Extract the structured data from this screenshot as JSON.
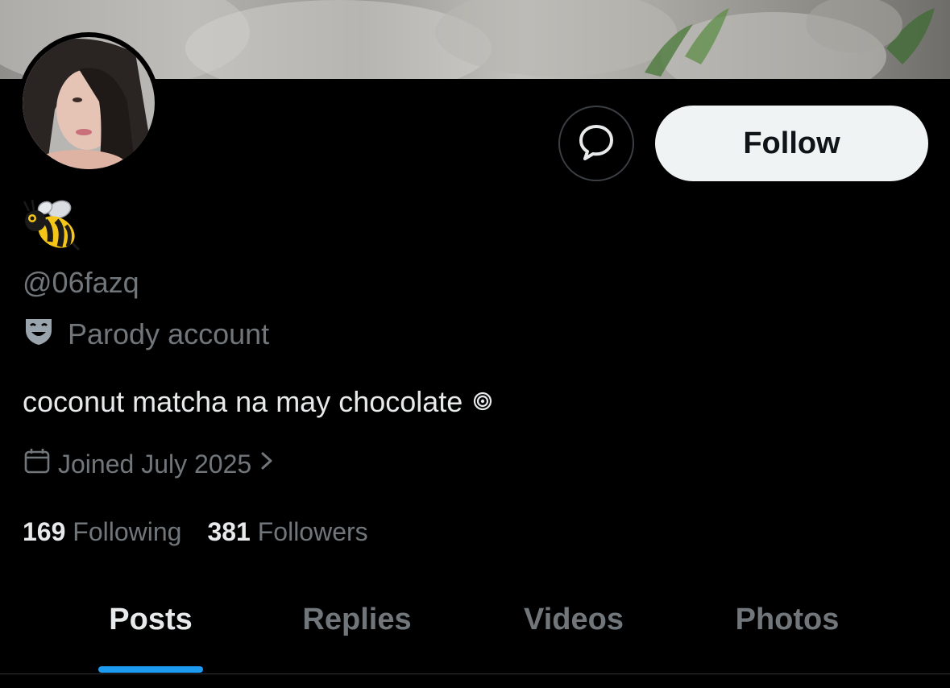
{
  "profile": {
    "display_name_icon": "bee-icon",
    "handle": "@06fazq",
    "parody_label": "Parody account",
    "parody_icon": "theater-mask-icon",
    "bio_text": "coconut matcha na may chocolate",
    "bio_icon": "spiral-icon",
    "joined": "Joined July 2025",
    "joined_icon": "calendar-icon",
    "joined_chevron_icon": "chevron-right-icon"
  },
  "actions": {
    "message_icon": "message-bubble-icon",
    "follow_label": "Follow"
  },
  "stats": {
    "following_count": "169",
    "following_label": "Following",
    "followers_count": "381",
    "followers_label": "Followers"
  },
  "tabs": [
    {
      "label": "Posts",
      "active": true
    },
    {
      "label": "Replies",
      "active": false
    },
    {
      "label": "Videos",
      "active": false
    },
    {
      "label": "Photos",
      "active": false
    }
  ],
  "colors": {
    "background": "#000000",
    "text_primary": "#e7e9ea",
    "text_secondary": "#71767b",
    "accent": "#1d9bf0",
    "follow_button_bg": "#eff3f4"
  }
}
